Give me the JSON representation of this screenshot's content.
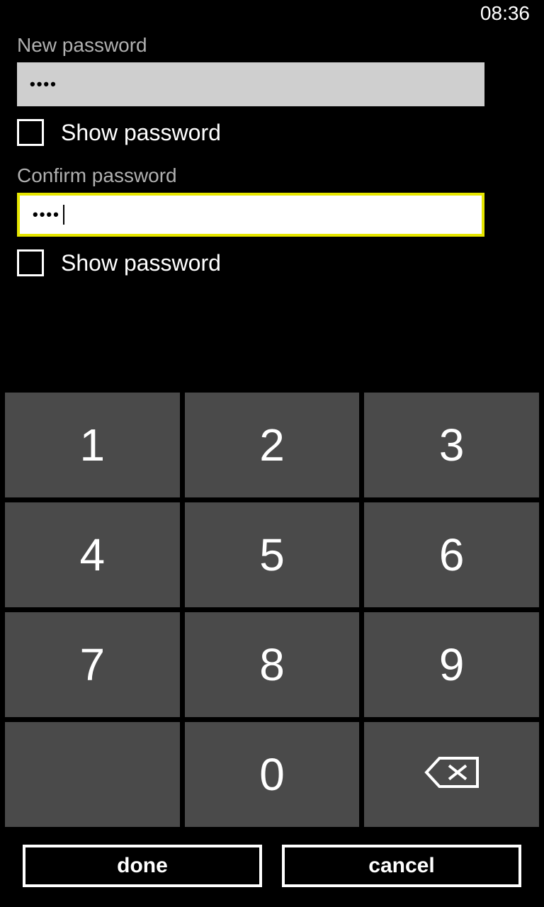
{
  "status_bar": {
    "time": "08:36"
  },
  "form": {
    "new_password": {
      "label": "New password",
      "masked_value": "••••",
      "show_password_label": "Show password",
      "show_password_checked": false
    },
    "confirm_password": {
      "label": "Confirm password",
      "masked_value": "••••",
      "show_password_label": "Show password",
      "show_password_checked": false
    }
  },
  "keypad": {
    "keys": [
      "1",
      "2",
      "3",
      "4",
      "5",
      "6",
      "7",
      "8",
      "9",
      "",
      "0",
      "backspace"
    ]
  },
  "footer": {
    "done_label": "done",
    "cancel_label": "cancel"
  }
}
